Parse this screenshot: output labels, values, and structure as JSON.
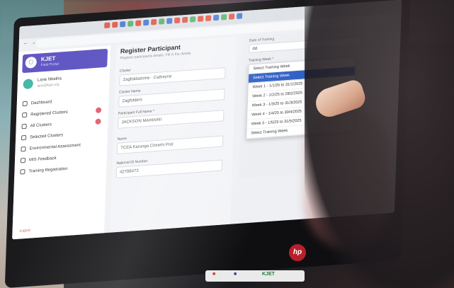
{
  "scene": {
    "description_colors": {
      "sidebar_brand": "#5a4fc0",
      "selected_option": "#2f5ec4",
      "hp_logo": "#b7202a"
    }
  },
  "app": {
    "brand_title": "KJET",
    "brand_subtitle": "Field Portal",
    "user_name": "Lane Nkatha",
    "user_email": "lane@kjet.org"
  },
  "menu": [
    {
      "label": "Dashboard",
      "icon": "grid-icon",
      "sub": "",
      "badge": false
    },
    {
      "label": "Registered Clusters",
      "icon": "folder-icon",
      "sub": "",
      "badge": true
    },
    {
      "label": "All Clusters",
      "icon": "folder-icon",
      "sub": "",
      "badge": true
    },
    {
      "label": "Selected Clusters",
      "icon": "check-icon",
      "sub": "",
      "badge": false
    },
    {
      "label": "Environmental Assessment",
      "icon": "leaf-icon",
      "sub": "",
      "badge": false
    },
    {
      "label": "MIS Feedback",
      "icon": "message-icon",
      "sub": "",
      "badge": false
    },
    {
      "label": "Training Registration",
      "icon": "plus-icon",
      "sub": "",
      "badge": false
    }
  ],
  "logout_label": "Logout",
  "form": {
    "title": "Register Participant",
    "subtitle": "Register participants details, Fill in the details",
    "fields": [
      {
        "label": "Cluster",
        "value": "Zagfoldastrine · Catheyne"
      },
      {
        "label": "Cluster Name",
        "value": "Zagfolders"
      },
      {
        "label": "Participant Full Name *",
        "value": "JACKSON MAHIAINI"
      },
      {
        "label": "Name",
        "value": "TCEA Karunga Chinehi Prol"
      },
      {
        "label": "National ID Number",
        "value": "42708473"
      }
    ]
  },
  "training": {
    "date_label": "Date of Training",
    "date_value": "dd",
    "label": "Training Week *",
    "options": [
      {
        "label": "Select Training Week",
        "selected": false
      },
      {
        "label": "Select Training Week",
        "selected": true
      },
      {
        "label": "Week 1 - 1/1/25 to 31/1/2025",
        "selected": false
      },
      {
        "label": "Week 2 - 1/2/25 to 28/2/2025",
        "selected": false
      },
      {
        "label": "Week 3 - 1/3/25 to 31/3/2025",
        "selected": false
      },
      {
        "label": "Week 4 - 1/4/25 to 30/4/2025",
        "selected": false
      },
      {
        "label": "Week 5 - 1/5/25 to 31/5/2025",
        "selected": false
      },
      {
        "label": "Select Training Week",
        "selected": false
      }
    ]
  },
  "hardware": {
    "logo": "hp"
  },
  "dock": {
    "items": [
      "KJET"
    ]
  }
}
